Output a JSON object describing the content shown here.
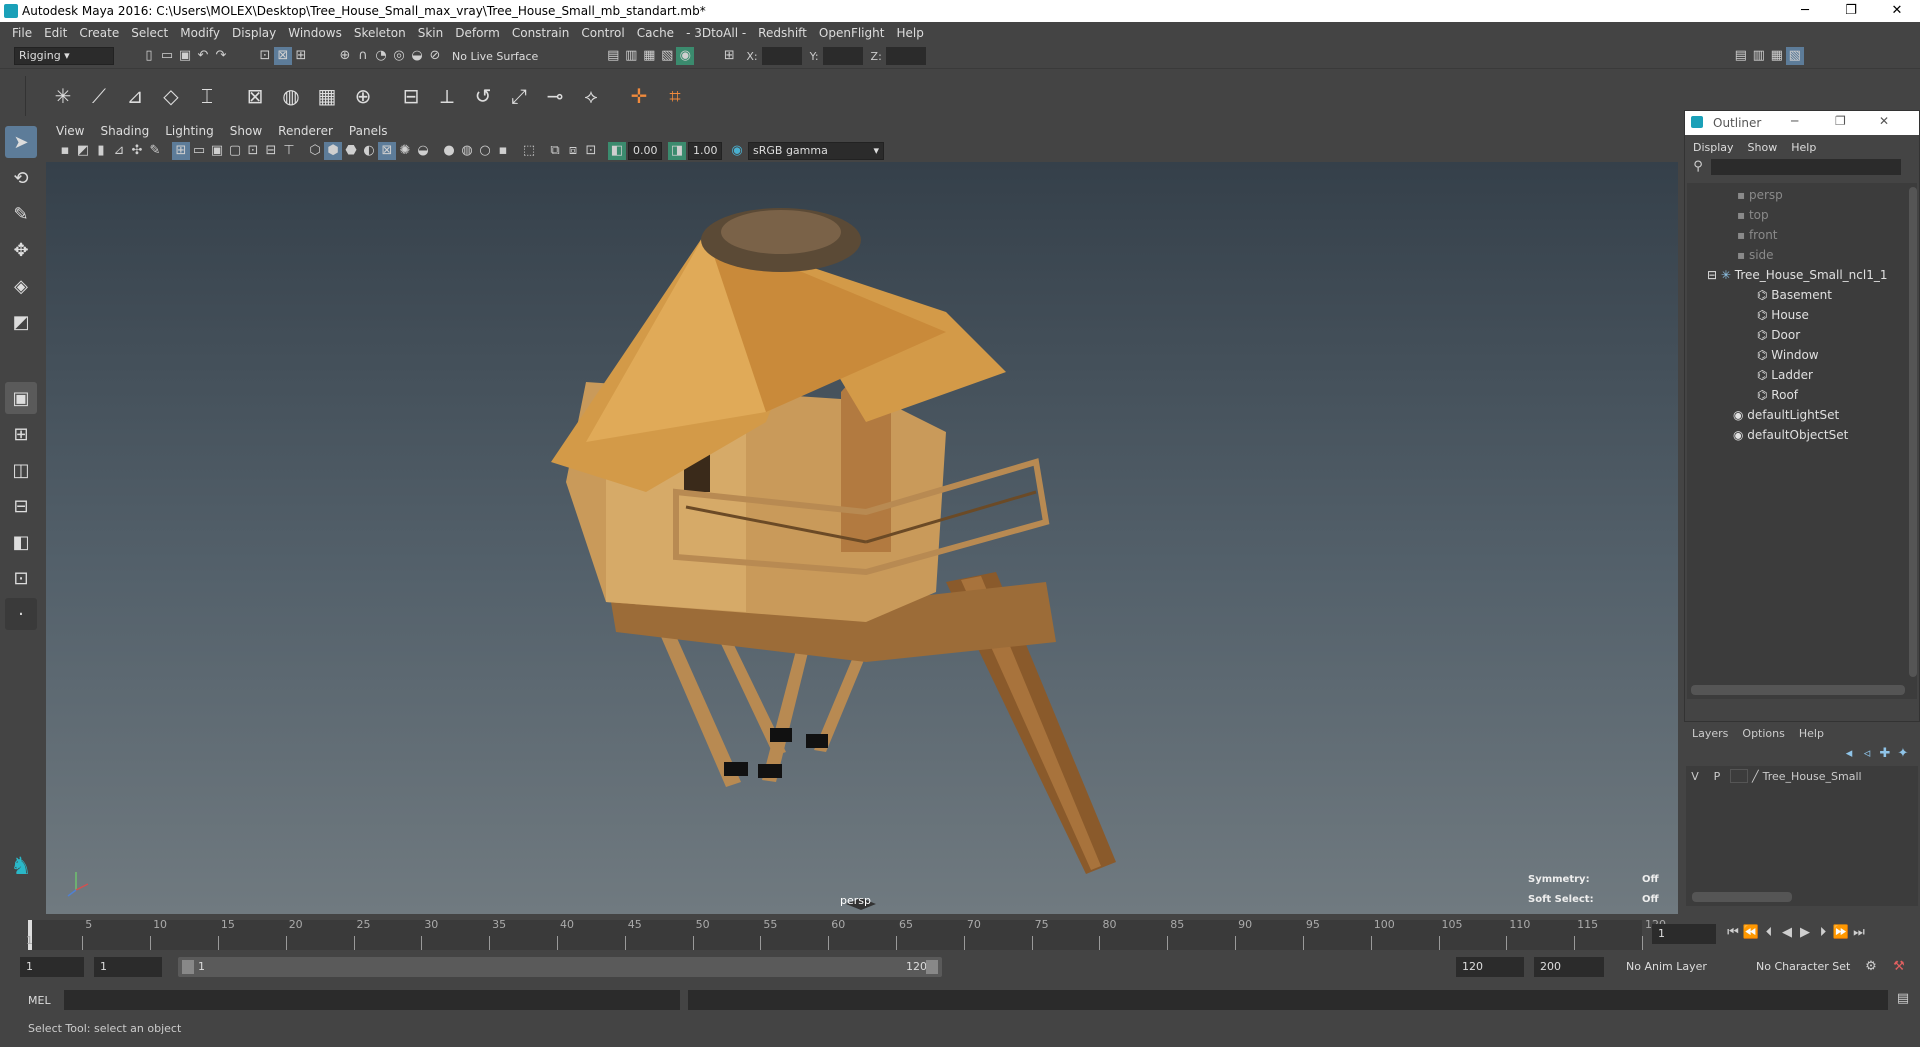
{
  "window": {
    "title": "Autodesk Maya 2016: C:\\Users\\MOLEX\\Desktop\\Tree_House_Small_max_vray\\Tree_House_Small_mb_standart.mb*",
    "minimize": "─",
    "restore": "❐",
    "close": "✕"
  },
  "menubar": [
    "File",
    "Edit",
    "Create",
    "Select",
    "Modify",
    "Display",
    "Windows",
    "Skeleton",
    "Skin",
    "Deform",
    "Constrain",
    "Control",
    "Cache",
    "- 3DtoAll -",
    "Redshift",
    "OpenFlight",
    "Help"
  ],
  "statusline": {
    "menuset": "Rigging",
    "live_surface": "No Live Surface",
    "x_label": "X:",
    "y_label": "Y:",
    "z_label": "Z:"
  },
  "viewport": {
    "menu": [
      "View",
      "Shading",
      "Lighting",
      "Show",
      "Renderer",
      "Panels"
    ],
    "exposure": "0.00",
    "gamma": "1.00",
    "colorspace": "sRGB gamma",
    "camera_label": "persp",
    "symmetry_label": "Symmetry:",
    "symmetry_value": "Off",
    "soft_select_label": "Soft Select:",
    "soft_select_value": "Off"
  },
  "outliner": {
    "title": "Outliner",
    "menu": [
      "Display",
      "Show",
      "Help"
    ],
    "items": [
      {
        "label": "persp",
        "kind": "camera",
        "indent": 2
      },
      {
        "label": "top",
        "kind": "camera",
        "indent": 2
      },
      {
        "label": "front",
        "kind": "camera",
        "indent": 2
      },
      {
        "label": "side",
        "kind": "camera",
        "indent": 2
      },
      {
        "label": "Tree_House_Small_ncl1_1",
        "kind": "group",
        "indent": 1
      },
      {
        "label": "Basement",
        "kind": "mesh",
        "indent": 3
      },
      {
        "label": "House",
        "kind": "mesh",
        "indent": 3
      },
      {
        "label": "Door",
        "kind": "mesh",
        "indent": 3
      },
      {
        "label": "Window",
        "kind": "mesh",
        "indent": 3
      },
      {
        "label": "Ladder",
        "kind": "mesh",
        "indent": 3
      },
      {
        "label": "Roof",
        "kind": "mesh",
        "indent": 3
      },
      {
        "label": "defaultLightSet",
        "kind": "set",
        "indent": 2
      },
      {
        "label": "defaultObjectSet",
        "kind": "set",
        "indent": 2
      }
    ]
  },
  "layers": {
    "menu": [
      "Layers",
      "Options",
      "Help"
    ],
    "layer_v": "V",
    "layer_p": "P",
    "layer_name": "Tree_House_Small"
  },
  "timeline": {
    "start_label": "1",
    "ticks": [
      "5",
      "10",
      "15",
      "20",
      "25",
      "30",
      "35",
      "40",
      "45",
      "50",
      "55",
      "60",
      "65",
      "70",
      "75",
      "80",
      "85",
      "90",
      "95",
      "100",
      "105",
      "110",
      "115",
      "120"
    ],
    "current_frame": "1"
  },
  "range": {
    "start": "1",
    "playback_start": "1",
    "slider_start": "1",
    "slider_end": "120",
    "playback_end": "120",
    "end": "200",
    "anim_layer": "No Anim Layer",
    "character_set": "No Character Set"
  },
  "cmdline": {
    "mode": "MEL"
  },
  "helpline": {
    "text": "Select Tool: select an object"
  }
}
